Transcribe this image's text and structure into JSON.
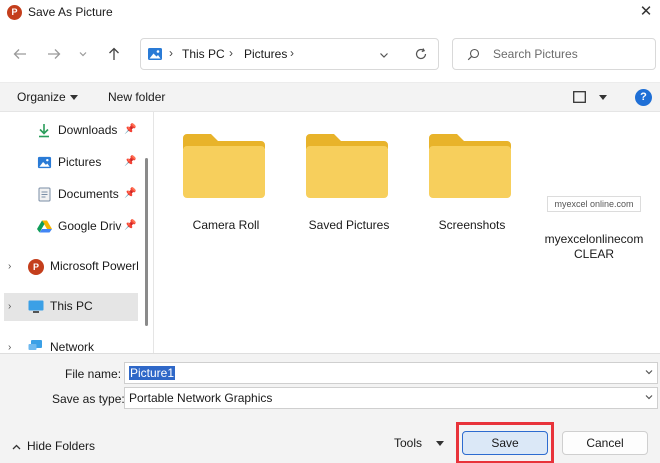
{
  "window": {
    "title": "Save As Picture",
    "app_icon_letter": "P",
    "close_glyph": "✕"
  },
  "nav": {
    "crumbs": [
      "This PC",
      "Pictures"
    ],
    "search_placeholder": "Search Pictures"
  },
  "toolbar": {
    "organize_label": "Organize",
    "new_folder_label": "New folder"
  },
  "sidebar": {
    "items": [
      {
        "label": "Downloads",
        "icon": "download-icon",
        "pinned": true
      },
      {
        "label": "Pictures",
        "icon": "pictures-icon",
        "pinned": true
      },
      {
        "label": "Documents",
        "icon": "documents-icon",
        "pinned": true
      },
      {
        "label": "Google Drive",
        "icon": "google-drive-icon",
        "pinned": true
      },
      {
        "label": "Microsoft PowerPoint",
        "icon": "powerpoint-icon"
      },
      {
        "label": "This PC",
        "icon": "monitor-icon",
        "selected": true
      },
      {
        "label": "Network",
        "icon": "network-icon"
      }
    ]
  },
  "content": {
    "items": [
      {
        "label": "Camera Roll",
        "type": "folder"
      },
      {
        "label": "Saved Pictures",
        "type": "folder"
      },
      {
        "label": "Screenshots",
        "type": "folder"
      },
      {
        "label": "myexcelonlinecomCLEAR",
        "type": "image",
        "thumbnail_text": "myexcel online.com"
      }
    ]
  },
  "form": {
    "file_name_label": "File name:",
    "file_name_value": "Picture1",
    "save_type_label": "Save as type:",
    "save_type_value": "Portable Network Graphics"
  },
  "footer": {
    "hide_folders_label": "Hide Folders",
    "tools_label": "Tools",
    "save_label": "Save",
    "cancel_label": "Cancel"
  },
  "colors": {
    "folder": "#f5c842",
    "accent": "#2c6bd0",
    "highlight": "#e8333a",
    "selection": "#2f68c8"
  }
}
